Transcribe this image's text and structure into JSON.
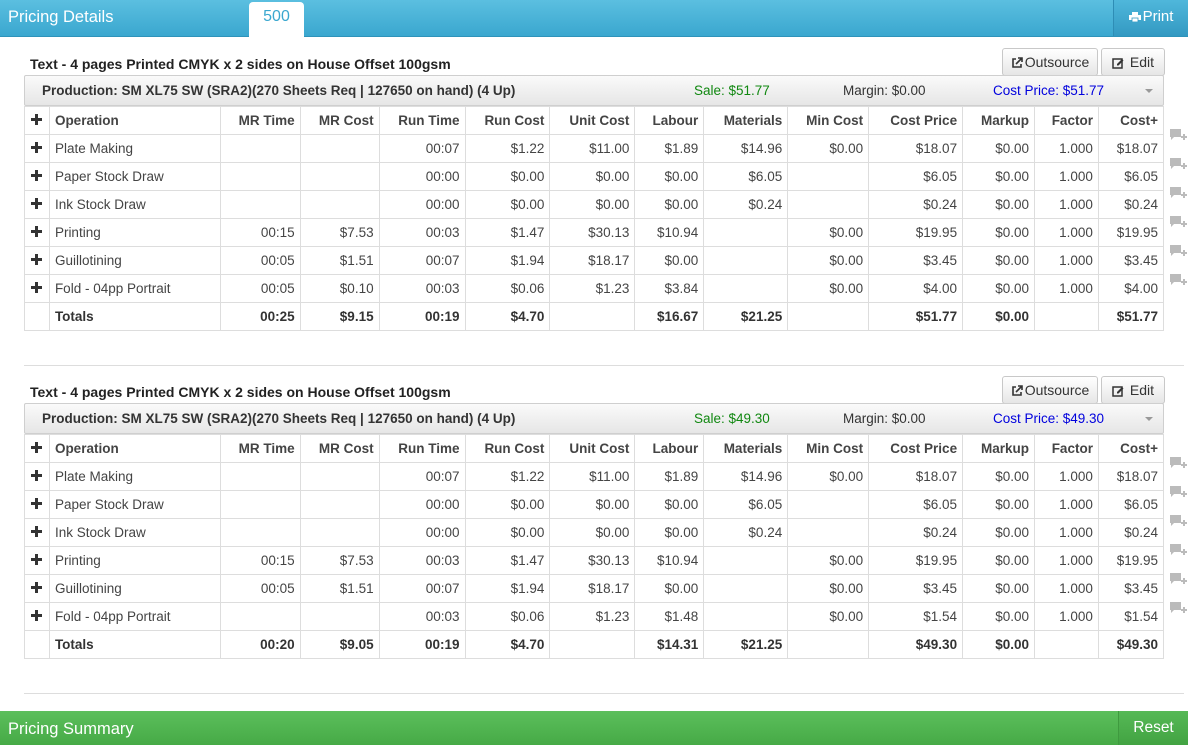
{
  "header": {
    "title": "Pricing Details",
    "active_tab": "500",
    "print_label": "Print"
  },
  "columns": [
    "Operation",
    "MR Time",
    "MR Cost",
    "Run Time",
    "Run Cost",
    "Unit Cost",
    "Labour",
    "Materials",
    "Min Cost",
    "Cost Price",
    "Markup",
    "Factor",
    "Cost+"
  ],
  "sections": [
    {
      "title": "Text - 4 pages Printed CMYK x 2 sides on House Offset 100gsm",
      "outsource_label": "Outsource",
      "edit_label": "Edit",
      "production": "Production: SM XL75 SW (SRA2)(270 Sheets Req | 127650 on hand) (4 Up)",
      "sale": "Sale: $51.77",
      "margin": "Margin: $0.00",
      "cost_price": "Cost Price: $51.77",
      "rows": [
        [
          "Plate Making",
          "",
          "",
          "00:07",
          "$1.22",
          "$11.00",
          "$1.89",
          "$14.96",
          "$0.00",
          "$18.07",
          "$0.00",
          "1.000",
          "$18.07"
        ],
        [
          "Paper Stock Draw",
          "",
          "",
          "00:00",
          "$0.00",
          "$0.00",
          "$0.00",
          "$6.05",
          "",
          "$6.05",
          "$0.00",
          "1.000",
          "$6.05"
        ],
        [
          "Ink Stock Draw",
          "",
          "",
          "00:00",
          "$0.00",
          "$0.00",
          "$0.00",
          "$0.24",
          "",
          "$0.24",
          "$0.00",
          "1.000",
          "$0.24"
        ],
        [
          "Printing",
          "00:15",
          "$7.53",
          "00:03",
          "$1.47",
          "$30.13",
          "$10.94",
          "",
          "$0.00",
          "$19.95",
          "$0.00",
          "1.000",
          "$19.95"
        ],
        [
          "Guillotining",
          "00:05",
          "$1.51",
          "00:07",
          "$1.94",
          "$18.17",
          "$0.00",
          "",
          "$0.00",
          "$3.45",
          "$0.00",
          "1.000",
          "$3.45"
        ],
        [
          "Fold - 04pp Portrait",
          "00:05",
          "$0.10",
          "00:03",
          "$0.06",
          "$1.23",
          "$3.84",
          "",
          "$0.00",
          "$4.00",
          "$0.00",
          "1.000",
          "$4.00"
        ]
      ],
      "totals": [
        "Totals",
        "00:25",
        "$9.15",
        "00:19",
        "$4.70",
        "",
        "$16.67",
        "$21.25",
        "",
        "$51.77",
        "$0.00",
        "",
        "$51.77"
      ]
    },
    {
      "title": "Text - 4 pages Printed CMYK x 2 sides on House Offset 100gsm",
      "outsource_label": "Outsource",
      "edit_label": "Edit",
      "production": "Production: SM XL75 SW (SRA2)(270 Sheets Req | 127650 on hand) (4 Up)",
      "sale": "Sale: $49.30",
      "margin": "Margin: $0.00",
      "cost_price": "Cost Price: $49.30",
      "rows": [
        [
          "Plate Making",
          "",
          "",
          "00:07",
          "$1.22",
          "$11.00",
          "$1.89",
          "$14.96",
          "$0.00",
          "$18.07",
          "$0.00",
          "1.000",
          "$18.07"
        ],
        [
          "Paper Stock Draw",
          "",
          "",
          "00:00",
          "$0.00",
          "$0.00",
          "$0.00",
          "$6.05",
          "",
          "$6.05",
          "$0.00",
          "1.000",
          "$6.05"
        ],
        [
          "Ink Stock Draw",
          "",
          "",
          "00:00",
          "$0.00",
          "$0.00",
          "$0.00",
          "$0.24",
          "",
          "$0.24",
          "$0.00",
          "1.000",
          "$0.24"
        ],
        [
          "Printing",
          "00:15",
          "$7.53",
          "00:03",
          "$1.47",
          "$30.13",
          "$10.94",
          "",
          "$0.00",
          "$19.95",
          "$0.00",
          "1.000",
          "$19.95"
        ],
        [
          "Guillotining",
          "00:05",
          "$1.51",
          "00:07",
          "$1.94",
          "$18.17",
          "$0.00",
          "",
          "$0.00",
          "$3.45",
          "$0.00",
          "1.000",
          "$3.45"
        ],
        [
          "Fold - 04pp Portrait",
          "",
          "",
          "00:03",
          "$0.06",
          "$1.23",
          "$1.48",
          "",
          "$0.00",
          "$1.54",
          "$0.00",
          "1.000",
          "$1.54"
        ]
      ],
      "totals": [
        "Totals",
        "00:20",
        "$9.05",
        "00:19",
        "$4.70",
        "",
        "$14.31",
        "$21.25",
        "",
        "$49.30",
        "$0.00",
        "",
        "$49.30"
      ]
    }
  ],
  "footer": {
    "title": "Pricing Summary",
    "reset_label": "Reset"
  },
  "colors": {
    "header_blue": "#3aa7cf",
    "footer_green": "#46aa46",
    "sale_green": "#118811",
    "cost_blue": "#0000dd"
  }
}
